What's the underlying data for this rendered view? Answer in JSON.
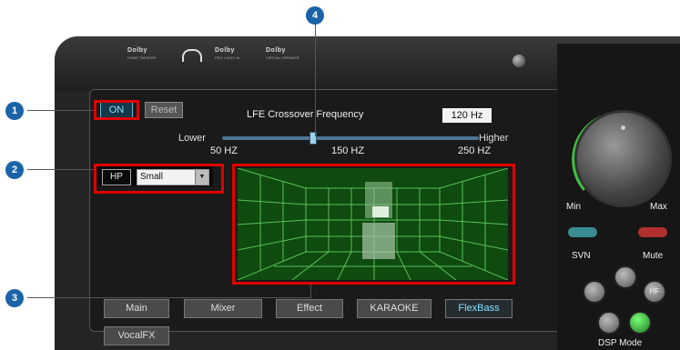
{
  "app": {
    "dolby_logos": [
      {
        "name": "Dolby",
        "sub": "HOME THEATER"
      },
      {
        "name": "Dolby",
        "sub": "PRO LOGIC IIx"
      },
      {
        "name": "Dolby",
        "sub": "VIRTUAL SPEAKER"
      }
    ]
  },
  "controls": {
    "on_label": "ON",
    "reset_label": "Reset",
    "crossover_label": "LFE Crossover Frequency",
    "crossover_value": "120 Hz",
    "slider_lower": "Lower",
    "slider_higher": "Higher",
    "ticks": [
      "50 HZ",
      "150 HZ",
      "250 HZ"
    ],
    "speaker_label": "HP",
    "speaker_size": "Small"
  },
  "tabs": [
    "Main",
    "Mixer",
    "Effect",
    "KARAOKE",
    "FlexBass",
    "VocalFX"
  ],
  "active_tab": "FlexBass",
  "right_panel": {
    "min_label": "Min",
    "max_label": "Max",
    "svn_label": "SVN",
    "mute_label": "Mute",
    "hf_label": "HF",
    "dsp_label": "DSP Mode"
  },
  "callouts": [
    "1",
    "2",
    "3",
    "4"
  ],
  "colors": {
    "accent": "#7fe0ff",
    "callout": "#1b63a8",
    "highlight": "#e00000",
    "room": "#0f4a0f"
  }
}
